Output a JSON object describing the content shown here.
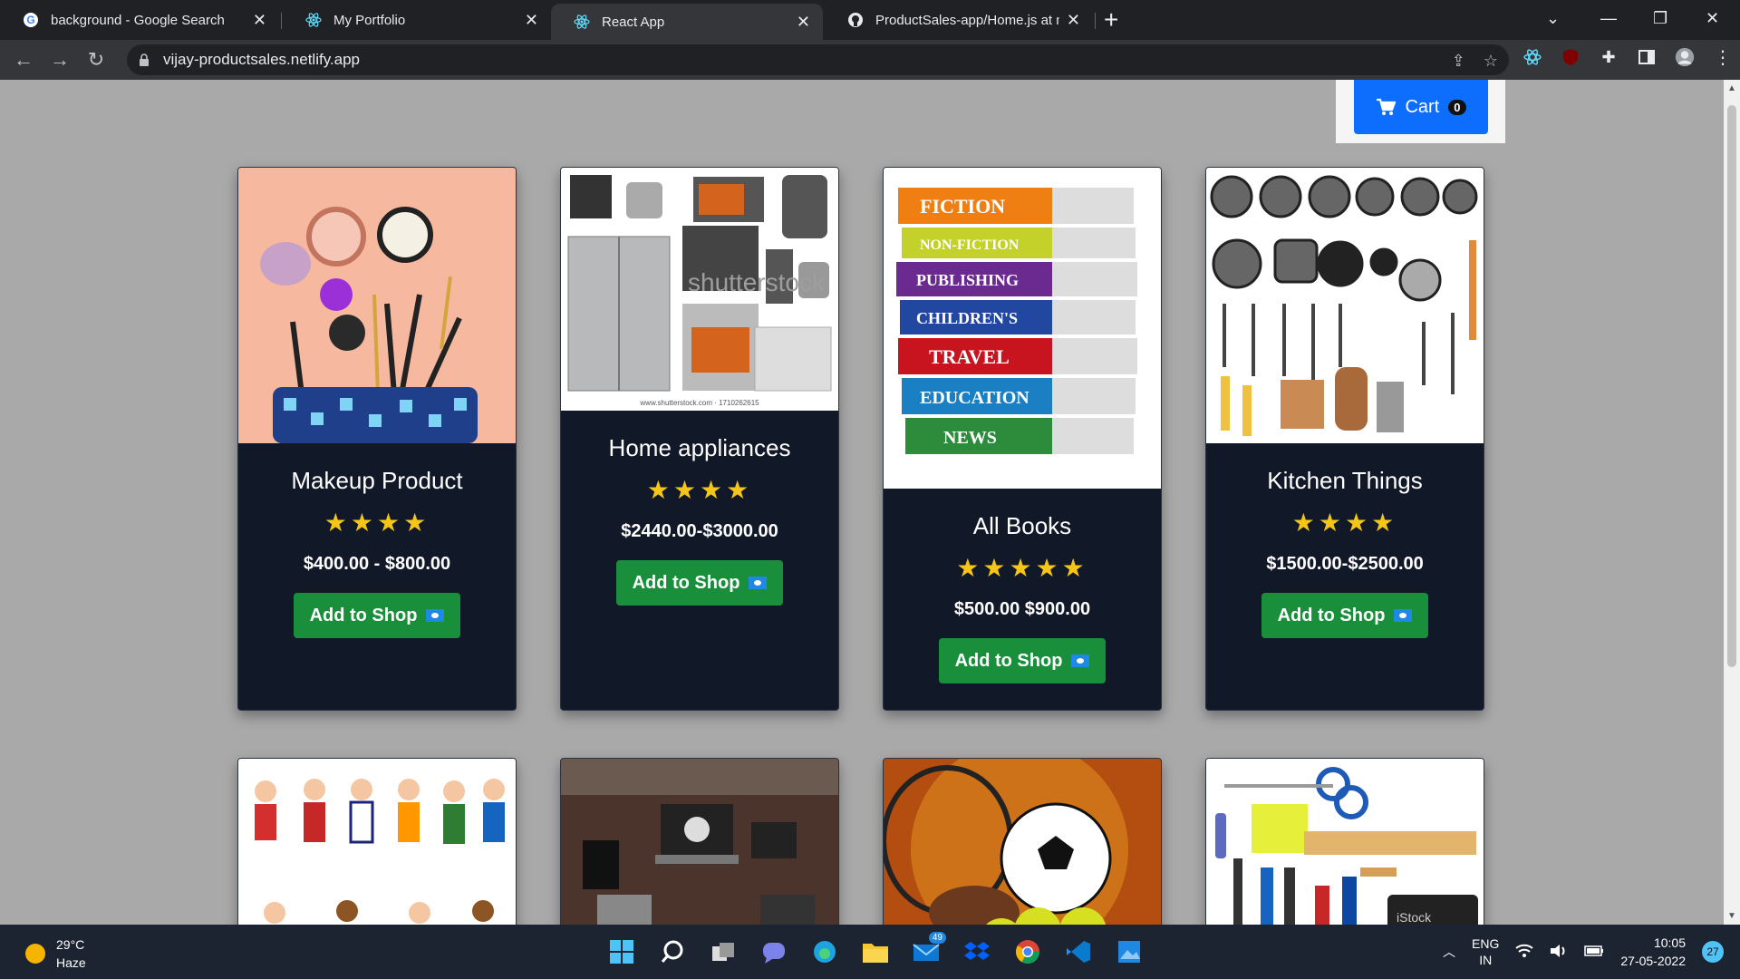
{
  "browser": {
    "tabs": [
      {
        "title": "background - Google Search",
        "favicon": "google-icon"
      },
      {
        "title": "My Portfolio",
        "favicon": "react-icon"
      },
      {
        "title": "React App",
        "favicon": "react-icon"
      },
      {
        "title": "ProductSales-app/Home.js at ma",
        "favicon": "github-icon"
      }
    ],
    "url": "vijay-productsales.netlify.app"
  },
  "cart": {
    "label": "Cart",
    "count": "0"
  },
  "products": [
    {
      "title": "Makeup Product",
      "stars": "★★★★",
      "price": "$400.00 - $800.00",
      "button": "Add to Shop",
      "image": "makeup-image"
    },
    {
      "title": "Home appliances",
      "stars": "★★★★",
      "price": "$2440.00-$3000.00",
      "button": "Add to Shop",
      "image": "appliances-image"
    },
    {
      "title": "All Books",
      "stars": "★★★★★",
      "price": "$500.00 $900.00",
      "button": "Add to Shop",
      "image": "books-image",
      "book_labels": [
        "FICTION",
        "NON-FICTION",
        "PUBLISHING",
        "CHILDREN'S",
        "TRAVEL",
        "EDUCATION",
        "NEWS"
      ]
    },
    {
      "title": "Kitchen Things",
      "stars": "★★★★",
      "price": "$1500.00-$2500.00",
      "button": "Add to Shop",
      "image": "kitchen-image"
    }
  ],
  "second_row": [
    {
      "image": "kids-image"
    },
    {
      "image": "workspace-image"
    },
    {
      "image": "sports-image"
    },
    {
      "image": "stationery-image"
    }
  ],
  "appliance_watermark": "shutterstock",
  "appliance_caption": "www.shutterstock.com · 1710262615",
  "stationery_watermark": "iStock",
  "taskbar": {
    "temp": "29°C",
    "weather": "Haze",
    "mail_badge": "49",
    "lang": "ENG",
    "region": "IN",
    "time": "10:05",
    "date": "27-05-2022",
    "notifications": "27"
  }
}
